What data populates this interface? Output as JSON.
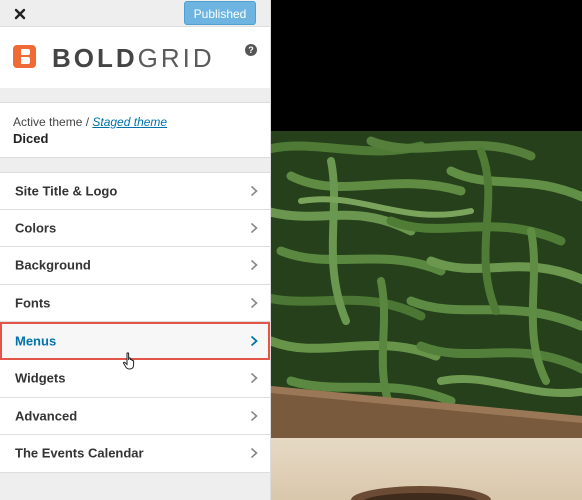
{
  "topbar": {
    "close_icon": "close-icon",
    "publish_label": "Published"
  },
  "brand": {
    "logo_text_bold": "BOLD",
    "logo_text_light": "GRID",
    "help_label": "?"
  },
  "theme": {
    "active_label": "Active theme /",
    "staged_link": "Staged theme",
    "name": "Diced"
  },
  "menu": {
    "items": [
      {
        "label": "Site Title & Logo"
      },
      {
        "label": "Colors"
      },
      {
        "label": "Background"
      },
      {
        "label": "Fonts"
      },
      {
        "label": "Menus",
        "active": true
      },
      {
        "label": "Widgets"
      },
      {
        "label": "Advanced"
      },
      {
        "label": "The Events Calendar"
      }
    ]
  },
  "colors": {
    "accent": "#0073aa",
    "highlight_border": "#e2564a",
    "publish_button": "#6db5e0",
    "brand_orange": "#f06a35"
  }
}
